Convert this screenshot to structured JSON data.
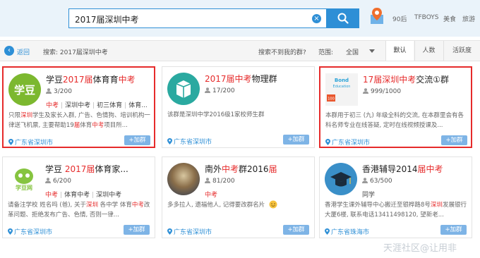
{
  "search": {
    "query": "2017届深圳中考"
  },
  "hot_tags": [
    "90后",
    "TFBOYS",
    "美食",
    "旅游"
  ],
  "filter_bar": {
    "back_label": "返回",
    "breadcrumb": "搜索: 2017届深圳中考",
    "not_found": "搜索不到我的群?",
    "range_label": "范围:",
    "range_value": "全国",
    "sort_tabs": [
      "默认",
      "人数",
      "活跃度"
    ]
  },
  "join_label": "+加群",
  "cards": [
    {
      "name_parts": [
        "学豆",
        "2017届",
        "体育育",
        "中考",
        ""
      ],
      "members": "3/200",
      "tags": [
        "中考",
        "深圳中考",
        "初三体育",
        "体育..."
      ],
      "desc_parts": [
        "只限",
        "深圳",
        "学生及家长入群, 广告、色情狗、培训机构一律送飞机票, 主要帮助19",
        "届",
        "体育",
        "中考",
        "项目所..."
      ],
      "location": "广东省深圳市"
    },
    {
      "name_parts": [
        "",
        "2017届",
        "",
        "中考",
        "物理群"
      ],
      "members": "17/200",
      "tags": [],
      "desc_parts": [
        "该群是深圳中学2016级1家校师生群",
        "",
        "",
        "",
        "",
        "",
        ""
      ],
      "location": "广东省深圳市"
    },
    {
      "name_parts": [
        "",
        "17届",
        "",
        "深圳中考",
        "交流①群"
      ],
      "members": "999/1000",
      "tags": [],
      "desc_parts": [
        "本群用于初三 (九) 年级全科的交流, 在本群里会有各科名师专业在线答疑, 定时在线视频授课及...",
        "",
        "",
        "",
        "",
        "",
        ""
      ],
      "location": "广东省深圳市"
    },
    {
      "name_parts": [
        "学豆 ",
        "2017届",
        "体育家...",
        "",
        ""
      ],
      "members": "6/200",
      "tags": [
        "中考",
        "体育中考",
        "深圳中考"
      ],
      "desc_parts": [
        "请备注学校 姓名吗 (爸), 关于",
        "深圳",
        " 各中学 体育",
        "中考",
        "改革问题、拒绝发布广告、色情, 否则一律...",
        "",
        ""
      ],
      "location": "广东省深圳市"
    },
    {
      "name_parts": [
        "南外",
        "中考",
        "群2016",
        "届",
        ""
      ],
      "members": "81/200",
      "tags": [
        "中考"
      ],
      "desc_parts": [
        "多多拉人, 遗福他人, 记得要改群名片",
        "",
        "",
        "",
        "",
        "",
        ""
      ],
      "location": "广东省深圳市"
    },
    {
      "name_parts": [
        "香港辅导2014",
        "届中考",
        "",
        "",
        ""
      ],
      "members": "63/500",
      "tags": [
        "同学"
      ],
      "desc_parts": [
        "香港学生课外辅导中心搬迁至银桦路8号",
        "深圳",
        "发展银行大厦6楼, 联系电话13411498120, 望新老...",
        "",
        "",
        "",
        ""
      ],
      "location": "广东省珠海市"
    }
  ],
  "watermark": "天涯社区@让用非",
  "colors": {
    "accent": "#2e8fd6",
    "highlight": "#e62b2b"
  }
}
